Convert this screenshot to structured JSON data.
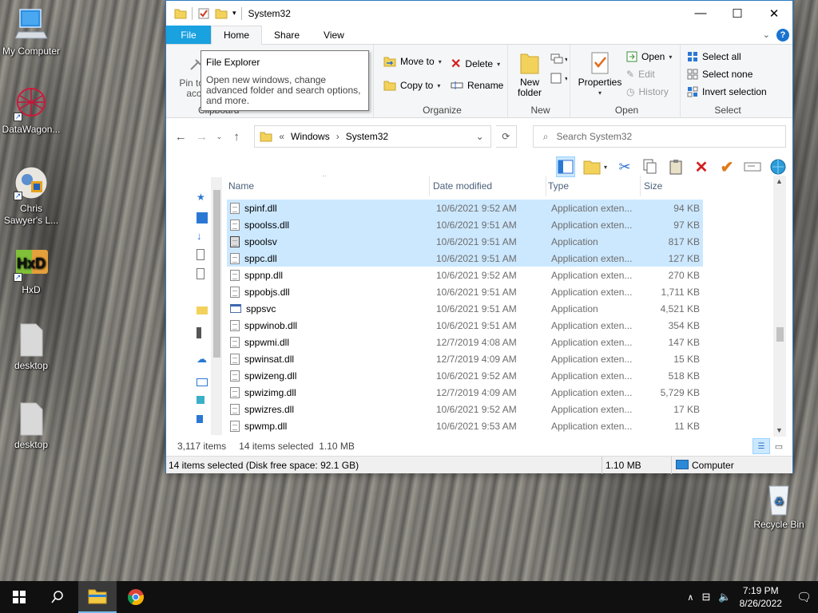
{
  "desktop": {
    "icons": [
      {
        "label": "My Computer",
        "icon": "computer-icon"
      },
      {
        "label": "DataWagon...",
        "icon": "datawagon-icon"
      },
      {
        "label": "Chris Sawyer's L...",
        "icon": "chris-sawyer-icon"
      },
      {
        "label": "HxD",
        "icon": "hxd-icon"
      },
      {
        "label": "desktop",
        "icon": "blank-file-icon"
      },
      {
        "label": "desktop",
        "icon": "blank-file-icon"
      },
      {
        "label": "Recycle Bin",
        "icon": "recycle-bin-icon"
      }
    ]
  },
  "window": {
    "title": "System32",
    "controls": {
      "minimize": "—",
      "maximize": "☐",
      "close": "✕"
    }
  },
  "ribbon": {
    "tabs": [
      {
        "label": "File"
      },
      {
        "label": "Home"
      },
      {
        "label": "Share"
      },
      {
        "label": "View"
      }
    ],
    "clipboard_group": {
      "pin_label": "Pin to Q",
      "access_label": "acce",
      "group_label": "Clipboard"
    },
    "organize": {
      "move_to": "Move to",
      "copy_to": "Copy to",
      "delete": "Delete",
      "rename": "Rename",
      "group_label": "Organize"
    },
    "new": {
      "new_folder_line1": "New",
      "new_folder_line2": "folder",
      "group_label": "New"
    },
    "open": {
      "properties": "Properties",
      "open": "Open",
      "edit": "Edit",
      "history": "History",
      "group_label": "Open"
    },
    "select": {
      "select_all": "Select all",
      "select_none": "Select none",
      "invert_selection": "Invert selection",
      "group_label": "Select"
    }
  },
  "tooltip": {
    "title": "File Explorer",
    "body": "Open new windows, change advanced folder and search options, and more."
  },
  "address": {
    "overflow": "«",
    "crumbs": [
      "Windows",
      "System32"
    ],
    "search_placeholder": "Search System32"
  },
  "columns": {
    "name": "Name",
    "date": "Date modified",
    "type": "Type",
    "size": "Size"
  },
  "files": [
    {
      "name": "spinf.dll",
      "date": "10/6/2021 9:52 AM",
      "type": "Application exten...",
      "size": "94 KB",
      "kind": "dll",
      "selected": true
    },
    {
      "name": "spoolss.dll",
      "date": "10/6/2021 9:51 AM",
      "type": "Application exten...",
      "size": "97 KB",
      "kind": "dll",
      "selected": true
    },
    {
      "name": "spoolsv",
      "date": "10/6/2021 9:51 AM",
      "type": "Application",
      "size": "817 KB",
      "kind": "printer",
      "selected": true
    },
    {
      "name": "sppc.dll",
      "date": "10/6/2021 9:51 AM",
      "type": "Application exten...",
      "size": "127 KB",
      "kind": "dll",
      "selected": true
    },
    {
      "name": "sppnp.dll",
      "date": "10/6/2021 9:52 AM",
      "type": "Application exten...",
      "size": "270 KB",
      "kind": "dll",
      "selected": false
    },
    {
      "name": "sppobjs.dll",
      "date": "10/6/2021 9:51 AM",
      "type": "Application exten...",
      "size": "1,711 KB",
      "kind": "dll",
      "selected": false
    },
    {
      "name": "sppsvc",
      "date": "10/6/2021 9:51 AM",
      "type": "Application",
      "size": "4,521 KB",
      "kind": "app",
      "selected": false
    },
    {
      "name": "sppwinob.dll",
      "date": "10/6/2021 9:51 AM",
      "type": "Application exten...",
      "size": "354 KB",
      "kind": "dll",
      "selected": false
    },
    {
      "name": "sppwmi.dll",
      "date": "12/7/2019 4:08 AM",
      "type": "Application exten...",
      "size": "147 KB",
      "kind": "dll",
      "selected": false
    },
    {
      "name": "spwinsat.dll",
      "date": "12/7/2019 4:09 AM",
      "type": "Application exten...",
      "size": "15 KB",
      "kind": "dll",
      "selected": false
    },
    {
      "name": "spwizeng.dll",
      "date": "10/6/2021 9:52 AM",
      "type": "Application exten...",
      "size": "518 KB",
      "kind": "dll",
      "selected": false
    },
    {
      "name": "spwizimg.dll",
      "date": "12/7/2019 4:09 AM",
      "type": "Application exten...",
      "size": "5,729 KB",
      "kind": "dll",
      "selected": false
    },
    {
      "name": "spwizres.dll",
      "date": "10/6/2021 9:52 AM",
      "type": "Application exten...",
      "size": "17 KB",
      "kind": "dll",
      "selected": false
    },
    {
      "name": "spwmp.dll",
      "date": "10/6/2021 9:53 AM",
      "type": "Application exten...",
      "size": "11 KB",
      "kind": "dll",
      "selected": false
    }
  ],
  "status": {
    "item_count": "3,117 items",
    "selected_info": "14 items selected  1.10 MB",
    "bottom_left": "14 items selected (Disk free space: 92.1 GB)",
    "bottom_size": "1.10 MB",
    "bottom_location": "Computer"
  },
  "taskbar": {
    "time": "7:19 PM",
    "date": "8/26/2022"
  },
  "colors": {
    "selection": "#cce8ff",
    "file_tab": "#19a1e0",
    "taskbar": "#101010"
  }
}
